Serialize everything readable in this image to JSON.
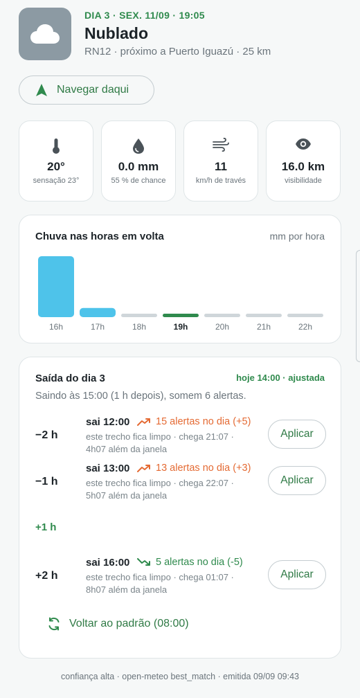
{
  "header": {
    "eyebrow": "DIA 3 · SEX. 11/09 · 19:05",
    "title": "Nublado",
    "subtitle": "RN12 · próximo a Puerto Iguazú · 25 km",
    "icon": "cloud-icon"
  },
  "navigate": {
    "label": "Navegar daqui",
    "icon": "navigation-arrow-icon"
  },
  "stats": [
    {
      "icon": "thermometer-icon",
      "value": "20°",
      "sub": "sensação 23°"
    },
    {
      "icon": "droplet-icon",
      "value": "0.0 mm",
      "sub": "55 % de chance"
    },
    {
      "icon": "wind-icon",
      "value": "11",
      "sub": "km/h de través"
    },
    {
      "icon": "eye-icon",
      "value": "16.0 km",
      "sub": "visibilidade"
    }
  ],
  "rain": {
    "title": "Chuva nas horas em volta",
    "unit": "mm por hora",
    "colors": {
      "rain": "#4ec3ea",
      "dry": "#cfd6da",
      "current": "#2f8a4d"
    }
  },
  "chart_data": {
    "type": "bar",
    "categories": [
      "16h",
      "17h",
      "18h",
      "19h",
      "20h",
      "21h",
      "22h"
    ],
    "values": [
      1.0,
      0.15,
      0,
      0,
      0,
      0,
      0
    ],
    "current_index": 3,
    "title": "Chuva nas horas em volta",
    "ylabel": "mm por hora",
    "grid": false
  },
  "departure": {
    "title": "Saída do dia 3",
    "status": "hoje 14:00 · ajustada",
    "description": "Saindo às 15:00 (1 h depois), somem 6 alertas.",
    "options": [
      {
        "offset": "−2 h",
        "time": "sai 12:00",
        "trend": "up",
        "alerts": "15 alertas no dia (+5)",
        "detail": "este trecho fica limpo · chega 21:07 · 4h07 além da janela",
        "apply": "Aplicar"
      },
      {
        "offset": "−1 h",
        "time": "sai 13:00",
        "trend": "up",
        "alerts": "13 alertas no dia (+3)",
        "detail": "este trecho fica limpo · chega 22:07 · 5h07 além da janela",
        "apply": "Aplicar"
      },
      {
        "offset": "+1 h",
        "current": true
      },
      {
        "offset": "+2 h",
        "time": "sai 16:00",
        "trend": "down",
        "alerts": "5 alertas no dia (-5)",
        "detail": "este trecho fica limpo · chega 01:07 · 8h07 além da janela",
        "apply": "Aplicar"
      }
    ],
    "reset": "Voltar ao padrão (08:00)"
  },
  "footer": "confiança alta · open-meteo best_match · emitida 09/09 09:43",
  "colors": {
    "accent": "#2f8a4d",
    "alert_up": "#e46a33",
    "tile": "#8c9aa3"
  }
}
